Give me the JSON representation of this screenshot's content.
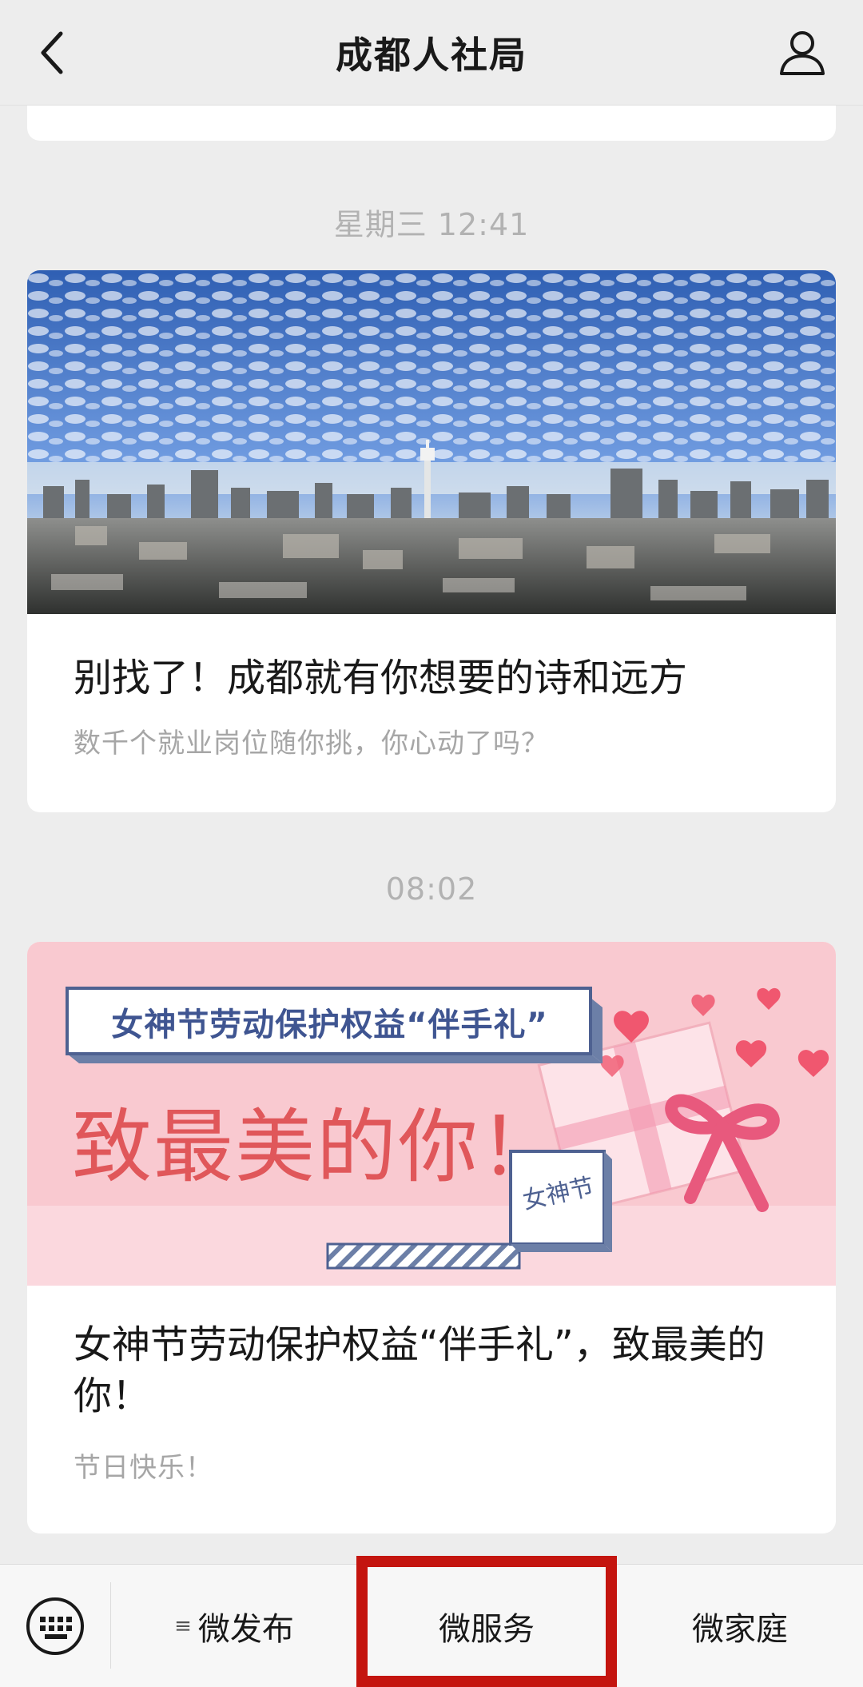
{
  "nav": {
    "title": "成都人社局"
  },
  "messages": [
    {
      "time": "星期三 12:41",
      "title": "别找了！成都就有你想要的诗和远方",
      "digest": "数千个就业岗位随你挑，你心动了吗？"
    },
    {
      "time": "08:02",
      "title": "女神节劳动保护权益“伴手礼”，致最美的你！",
      "digest": "节日快乐！",
      "cover": {
        "banner_text": "女神节劳动保护权益“伴手礼”",
        "main_text": "致最美的你！",
        "tag_text": "女神节"
      }
    }
  ],
  "menu": {
    "items": [
      "微发布",
      "微服务",
      "微家庭"
    ],
    "first_item_icon": "menu-lines-icon"
  },
  "colors": {
    "highlight": "#c4150f",
    "banner_pink": "#f9c9d0",
    "banner_red": "#e0575a"
  }
}
